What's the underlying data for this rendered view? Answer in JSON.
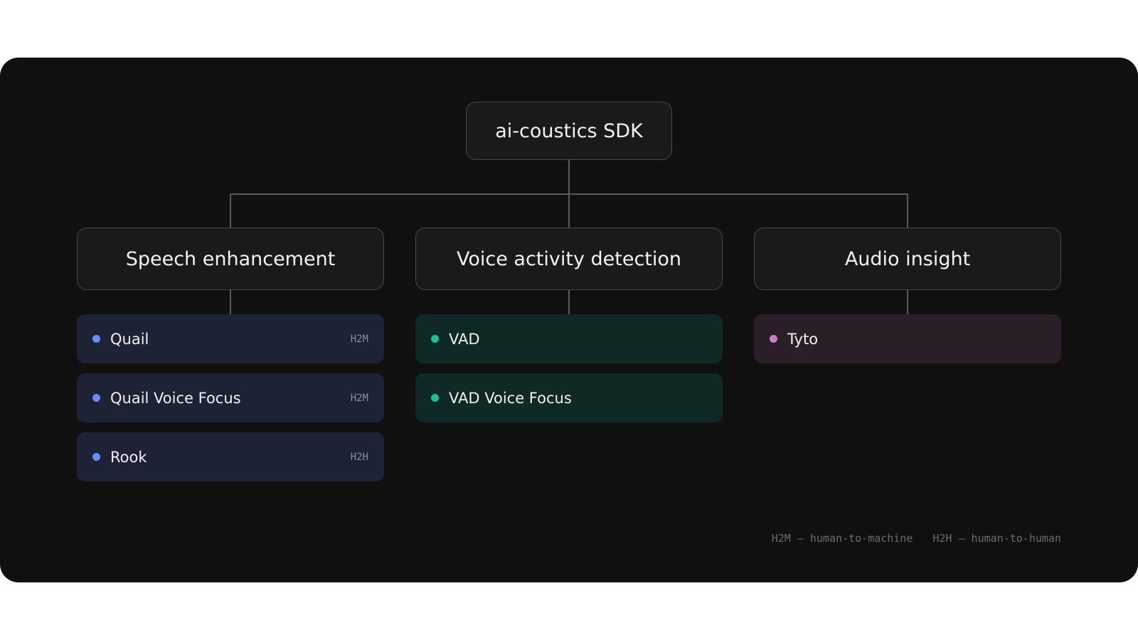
{
  "root": {
    "label": "ai-coustics SDK"
  },
  "categories": [
    {
      "label": "Speech enhancement",
      "color_bg": "#1d2334",
      "color_dot": "#6c8cff",
      "items": [
        {
          "label": "Quail",
          "tag": "H2M"
        },
        {
          "label": "Quail Voice Focus",
          "tag": "H2M"
        },
        {
          "label": "Rook",
          "tag": "H2H"
        }
      ]
    },
    {
      "label": "Voice activity detection",
      "color_bg": "#0e2926",
      "color_dot": "#17c29a",
      "items": [
        {
          "label": "VAD",
          "tag": ""
        },
        {
          "label": "VAD Voice Focus",
          "tag": ""
        }
      ]
    },
    {
      "label": "Audio insight",
      "color_bg": "#2a1e28",
      "color_dot": "#c87fc3",
      "items": [
        {
          "label": "Tyto",
          "tag": ""
        }
      ]
    }
  ],
  "legend": {
    "h2m": "H2M — human-to-machine",
    "h2h": "H2H — human-to-human"
  },
  "colors": {
    "panel_bg": "#101010",
    "box_bg": "#1a1a1a",
    "box_border": "#4a4a4a",
    "connector": "#5a5a5a"
  }
}
